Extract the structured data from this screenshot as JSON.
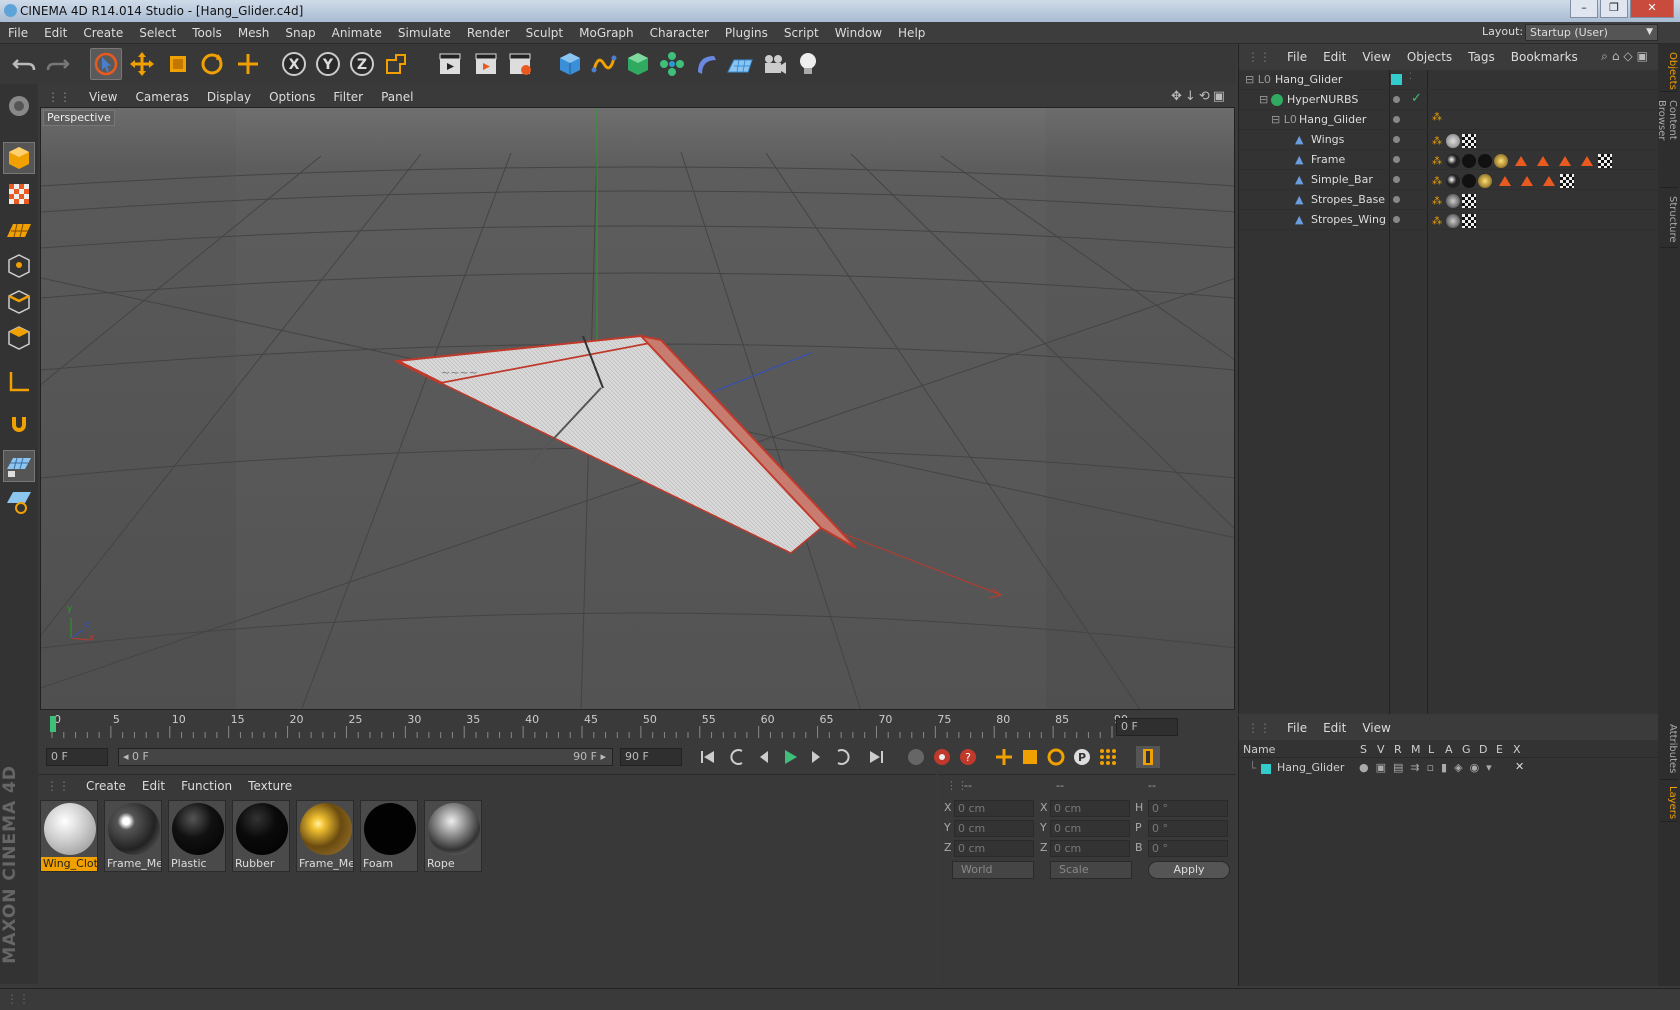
{
  "window": {
    "title": "CINEMA 4D R14.014 Studio - [Hang_Glider.c4d]",
    "min": "–",
    "max": "❐",
    "close": "✕"
  },
  "menu": [
    "File",
    "Edit",
    "Create",
    "Select",
    "Tools",
    "Mesh",
    "Snap",
    "Animate",
    "Simulate",
    "Render",
    "Sculpt",
    "MoGraph",
    "Character",
    "Plugins",
    "Script",
    "Window",
    "Help"
  ],
  "layout": {
    "label": "Layout:",
    "value": "Startup (User)"
  },
  "viewport": {
    "menu": [
      "View",
      "Cameras",
      "Display",
      "Options",
      "Filter",
      "Panel"
    ],
    "label": "Perspective",
    "axes": {
      "x": "x",
      "y": "y",
      "z": "z"
    }
  },
  "timeline": {
    "ticks": [
      "0",
      "5",
      "10",
      "15",
      "20",
      "25",
      "30",
      "35",
      "40",
      "45",
      "50",
      "55",
      "60",
      "65",
      "70",
      "75",
      "80",
      "85",
      "90"
    ],
    "current_frame": "0 F",
    "start": "0 F",
    "range_start": "◂ 0 F",
    "range_end": "90 F ▸",
    "end": "90 F"
  },
  "materials": {
    "menu": [
      "Create",
      "Edit",
      "Function",
      "Texture"
    ],
    "items": [
      {
        "name": "Wing_Cloth",
        "selected": true
      },
      {
        "name": "Frame_Met"
      },
      {
        "name": "Plastic"
      },
      {
        "name": "Rubber"
      },
      {
        "name": "Frame_Met"
      },
      {
        "name": "Foam"
      },
      {
        "name": "Rope"
      }
    ]
  },
  "coords": {
    "headers": [
      "--",
      "--",
      "--"
    ],
    "rows": [
      {
        "a": "X",
        "av": "0 cm",
        "b": "X",
        "bv": "0 cm",
        "c": "H",
        "cv": "0 °"
      },
      {
        "a": "Y",
        "av": "0 cm",
        "b": "Y",
        "bv": "0 cm",
        "c": "P",
        "cv": "0 °"
      },
      {
        "a": "Z",
        "av": "0 cm",
        "b": "Z",
        "bv": "0 cm",
        "c": "B",
        "cv": "0 °"
      }
    ],
    "mode1": "World",
    "mode2": "Scale",
    "apply": "Apply"
  },
  "objects": {
    "menu": [
      "File",
      "Edit",
      "View",
      "Objects",
      "Tags",
      "Bookmarks"
    ],
    "rows": [
      {
        "name": "Hang_Glider"
      },
      {
        "name": "HyperNURBS"
      },
      {
        "name": "Hang_Glider"
      },
      {
        "name": "Wings"
      },
      {
        "name": "Frame"
      },
      {
        "name": "Simple_Bar"
      },
      {
        "name": "Stropes_Base"
      },
      {
        "name": "Stropes_Wing"
      }
    ]
  },
  "layers": {
    "menu": [
      "File",
      "Edit",
      "View"
    ],
    "headers": {
      "name": "Name",
      "cols": [
        "S",
        "V",
        "R",
        "M",
        "L",
        "A",
        "G",
        "D",
        "E",
        "X"
      ]
    },
    "rows": [
      {
        "name": "Hang_Glider"
      }
    ]
  },
  "side_tabs": [
    "Objects",
    "Content Browser",
    "Structure"
  ],
  "side_tabs_bottom": [
    "Attributes",
    "Layers"
  ],
  "brand": "MAXON CINEMA 4D",
  "colors": {
    "accent": "#f0a000",
    "layer_color": "#33cccc",
    "x_axis": "#c0392b",
    "y_axis": "#27ae60",
    "z_axis": "#3050c0"
  }
}
